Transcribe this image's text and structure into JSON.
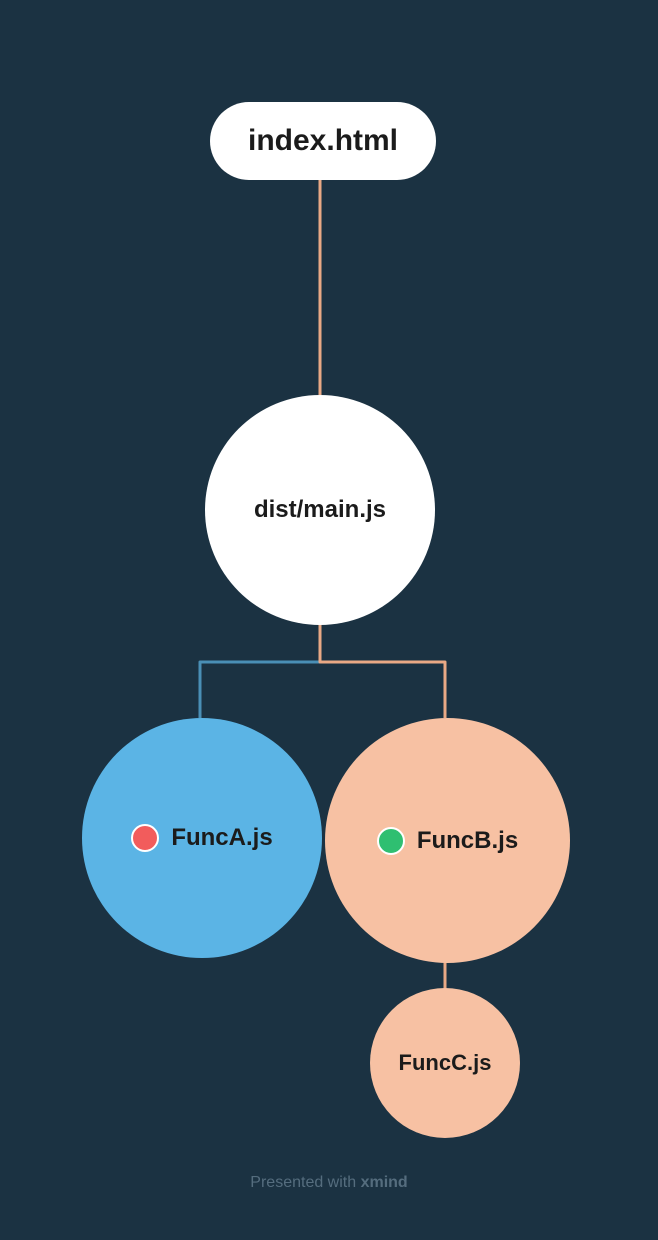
{
  "nodes": {
    "root": {
      "label": "index.html"
    },
    "main": {
      "label": "dist/main.js"
    },
    "funcA": {
      "label": "FuncA.js",
      "dotColor": "#f25c5c"
    },
    "funcB": {
      "label": "FuncB.js",
      "dotColor": "#2fbf71"
    },
    "funcC": {
      "label": "FuncC.js"
    }
  },
  "footer": {
    "prefix": "Presented with ",
    "brand": "xmind"
  },
  "colors": {
    "background": "#1b3242",
    "white": "#ffffff",
    "blue": "#5bb4e5",
    "peach": "#f7c1a3",
    "edgeBlue": "#4a8fb5",
    "edgePeach": "#e9a985"
  }
}
